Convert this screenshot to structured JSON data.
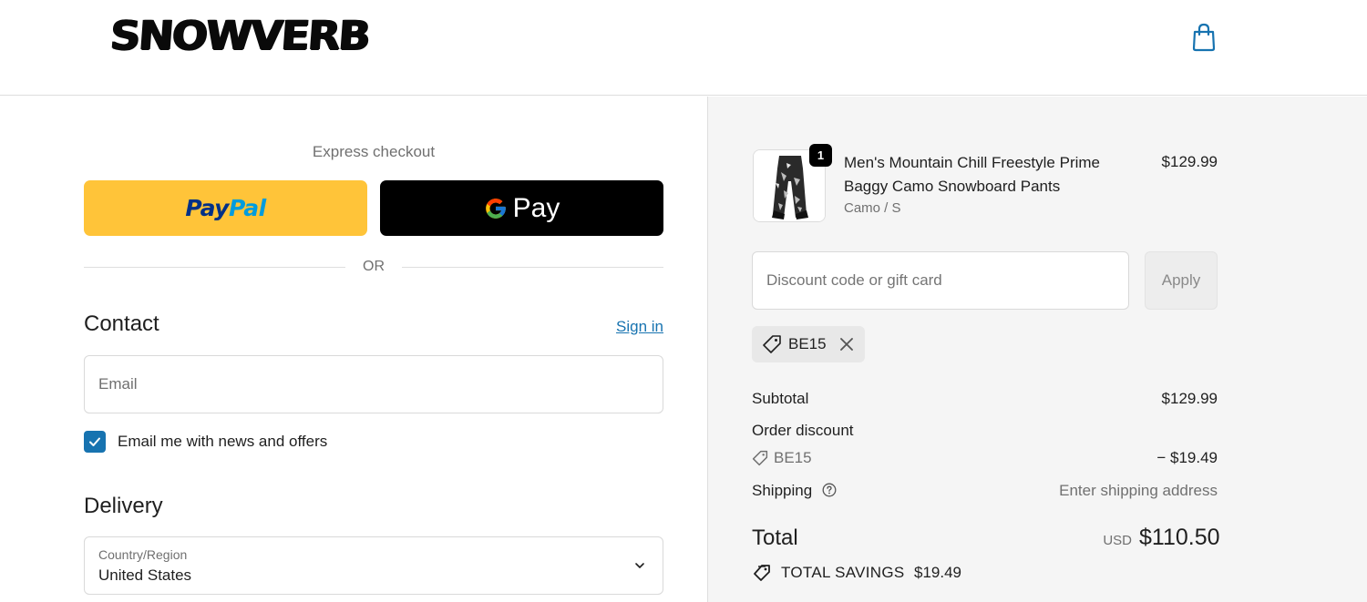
{
  "header": {
    "logo_text": "SNOWVERB",
    "cart_icon": "shopping-bag-icon"
  },
  "express": {
    "title": "Express checkout",
    "paypal_pay": "Pay",
    "paypal_pal": "Pal",
    "gpay_label": "Pay",
    "or_text": "OR"
  },
  "contact": {
    "title": "Contact",
    "signin_label": "Sign in",
    "email_placeholder": "Email",
    "newsletter_label": "Email me with news and offers",
    "newsletter_checked": true
  },
  "delivery": {
    "title": "Delivery",
    "country_label": "Country/Region",
    "country_value": "United States"
  },
  "order": {
    "product": {
      "name": "Men's Mountain Chill Freestyle Prime Baggy Camo Snowboard Pants",
      "variant": "Camo / S",
      "price": "$129.99",
      "quantity": "1"
    },
    "discount_placeholder": "Discount code or gift card",
    "apply_label": "Apply",
    "applied_code": "BE15",
    "summary": {
      "subtotal_label": "Subtotal",
      "subtotal_value": "$129.99",
      "order_discount_label": "Order discount",
      "discount_code": "BE15",
      "discount_value": "− $19.49",
      "shipping_label": "Shipping",
      "shipping_value": "Enter shipping address",
      "total_label": "Total",
      "currency": "USD",
      "total_value": "$110.50",
      "savings_label": "TOTAL SAVINGS",
      "savings_value": "$19.49"
    }
  },
  "colors": {
    "paypal_yellow": "#ffc439",
    "link_blue": "#1773b0",
    "summary_bg": "#f5f5f5"
  }
}
